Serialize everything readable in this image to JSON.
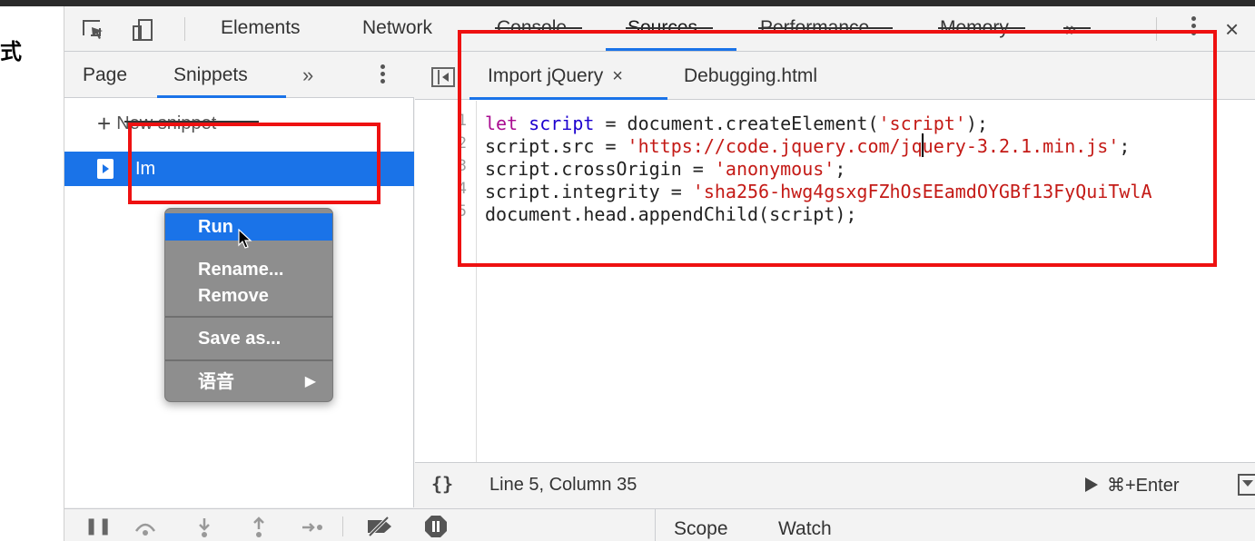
{
  "left_strip": {
    "char": "式"
  },
  "toolbar": {
    "tabs": [
      "Elements",
      "Network",
      "Console",
      "Sources",
      "Performance",
      "Memory"
    ],
    "more": "»",
    "close": "×"
  },
  "navigator": {
    "tabs": [
      "Page",
      "Snippets"
    ],
    "more": "»",
    "new_snippet": "New snippet",
    "snippet_name": "Im"
  },
  "context_menu": {
    "items": [
      "Run",
      "Rename...",
      "Remove",
      "Save as...",
      "语音"
    ],
    "submenu_arrow": "▶"
  },
  "editor": {
    "tabs": [
      {
        "label": "Import jQuery",
        "close": "×"
      },
      {
        "label": "Debugging.html"
      }
    ],
    "lines": [
      {
        "num": "1",
        "tokens": [
          {
            "t": "let ",
            "c": "kw"
          },
          {
            "t": "script",
            "c": "var"
          },
          {
            "t": " = document.createElement(",
            "c": ""
          },
          {
            "t": "'script'",
            "c": "str"
          },
          {
            "t": ");",
            "c": ""
          }
        ]
      },
      {
        "num": "2",
        "tokens": [
          {
            "t": "script.src = ",
            "c": ""
          },
          {
            "t": "'https://code.jquery.com/jquery-3.2.1.min.js'",
            "c": "str"
          },
          {
            "t": ";",
            "c": ""
          }
        ]
      },
      {
        "num": "3",
        "tokens": [
          {
            "t": "script.crossOrigin = ",
            "c": ""
          },
          {
            "t": "'anonymous'",
            "c": "str"
          },
          {
            "t": ";",
            "c": ""
          }
        ]
      },
      {
        "num": "4",
        "tokens": [
          {
            "t": "script.integrity = ",
            "c": ""
          },
          {
            "t": "'sha256-hwg4gsxgFZhOsEEamdOYGBf13FyQuiTwlA",
            "c": "str"
          }
        ]
      },
      {
        "num": "5",
        "tokens": [
          {
            "t": "document.head.appendChild(script);",
            "c": ""
          }
        ]
      }
    ]
  },
  "status": {
    "braces": "{}",
    "cursor": "Line 5, Column 35",
    "run_shortcut": "⌘+Enter"
  },
  "debugger": {
    "side_tabs": [
      "Scope",
      "Watch"
    ]
  },
  "colors": {
    "accent": "#1a73e8",
    "annotation": "#ee1111",
    "string": "#c41a16",
    "keyword": "#aa0d91",
    "variable": "#1c00cf"
  }
}
